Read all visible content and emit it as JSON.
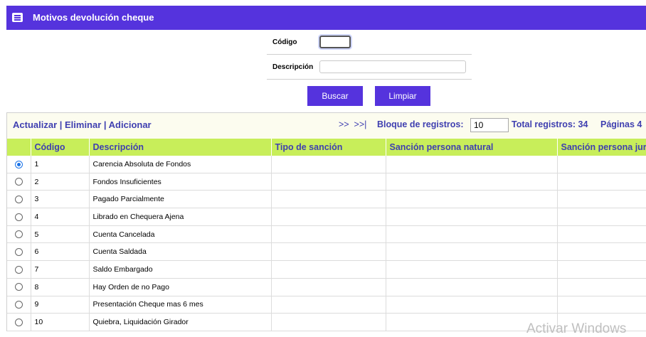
{
  "title": "Motivos devolución cheque",
  "filters": {
    "codigo_label": "Código",
    "codigo_value": "",
    "descripcion_label": "Descripción",
    "descripcion_value": ""
  },
  "buttons": {
    "buscar": "Buscar",
    "limpiar": "Limpiar"
  },
  "toolbar": {
    "actions": "Actualizar | Eliminar | Adicionar",
    "nav": ">>  >>|",
    "bloque_label": "Bloque de registros:",
    "bloque_value": "10",
    "total_label": "Total registros: 34",
    "paginas_label": "Páginas 4"
  },
  "table": {
    "columns": [
      "Código",
      "Descripción",
      "Tipo de sanción",
      "Sanción persona natural",
      "Sanción persona jurídica"
    ],
    "rows": [
      {
        "selected": true,
        "codigo": "1",
        "descripcion": "Carencia Absoluta de Fondos"
      },
      {
        "selected": false,
        "codigo": "2",
        "descripcion": "Fondos Insuficientes"
      },
      {
        "selected": false,
        "codigo": "3",
        "descripcion": "Pagado Parcialmente"
      },
      {
        "selected": false,
        "codigo": "4",
        "descripcion": "Librado en Chequera Ajena"
      },
      {
        "selected": false,
        "codigo": "5",
        "descripcion": "Cuenta Cancelada"
      },
      {
        "selected": false,
        "codigo": "6",
        "descripcion": "Cuenta Saldada"
      },
      {
        "selected": false,
        "codigo": "7",
        "descripcion": "Saldo Embargado"
      },
      {
        "selected": false,
        "codigo": "8",
        "descripcion": "Hay Orden de no Pago"
      },
      {
        "selected": false,
        "codigo": "9",
        "descripcion": "Presentación Cheque mas 6 mes"
      },
      {
        "selected": false,
        "codigo": "10",
        "descripcion": "Quiebra, Liquidación Girador"
      }
    ]
  },
  "watermark": "Activar Windows",
  "colors": {
    "header_bg": "#5533dd",
    "button_bg": "#5533dd",
    "table_header_bg": "#c8ee5a",
    "link_color": "#3f3fb0"
  },
  "icons": {
    "title_icon": "list-icon"
  }
}
